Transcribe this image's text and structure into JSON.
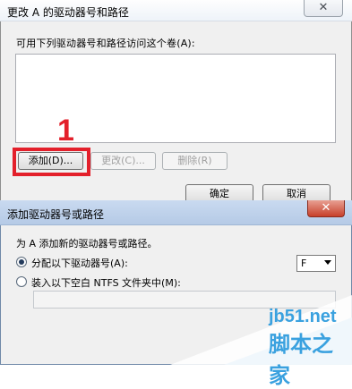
{
  "back_dialog": {
    "title": "更改 A 的驱动器号和路径",
    "available_label": "可用下列驱动器号和路径访问这个卷(A):",
    "buttons": {
      "add": "添加(D)...",
      "change": "更改(C)...",
      "remove": "删除(R)",
      "ok": "确定",
      "cancel": "取消"
    },
    "close_glyph": "✕",
    "annotation_number": "1",
    "highlight_color": "#e3202b"
  },
  "front_dialog": {
    "title": "添加驱动器号或路径",
    "hint": "为 A 添加新的驱动器号或路径。",
    "option_assign_label": "分配以下驱动器号(A):",
    "option_assign_checked": true,
    "drive_letter_value": "F",
    "option_mount_label": "装入以下空白 NTFS 文件夹中(M):",
    "option_mount_checked": false,
    "mount_path_value": "",
    "close_glyph": "✕"
  },
  "watermark": {
    "site": "jb51.net",
    "name": "脚本之家",
    "color": "#3aa1df"
  }
}
